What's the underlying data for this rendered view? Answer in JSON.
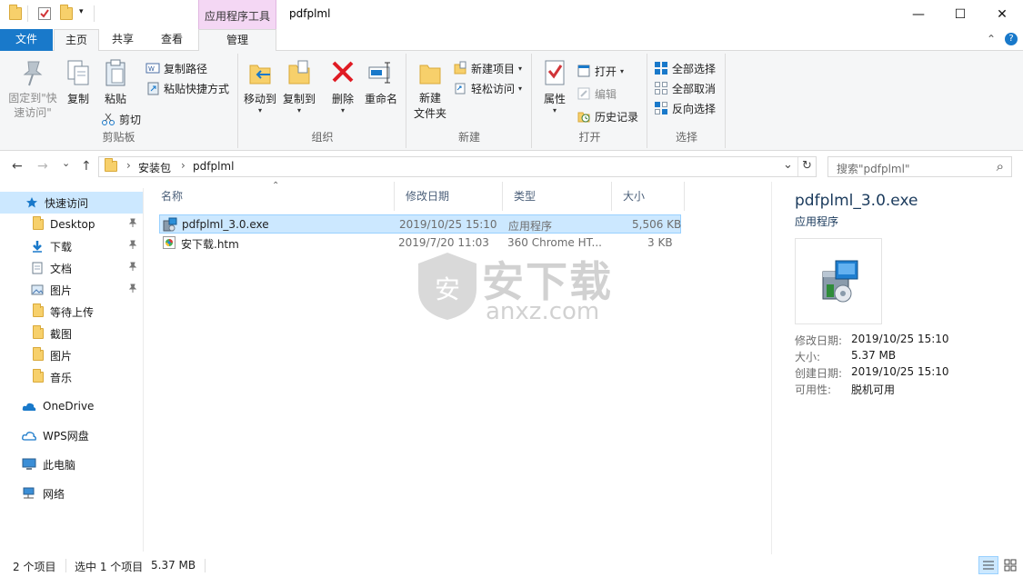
{
  "window": {
    "title": "pdfplml",
    "context_tab_header": "应用程序工具",
    "minimize_glyph": "—",
    "maximize_glyph": "☐",
    "close_glyph": "✕"
  },
  "ribbon_tabs": {
    "file": "文件",
    "home": "主页",
    "share": "共享",
    "view": "查看",
    "manage": "管理",
    "collapse_glyph": "⌃",
    "help_glyph": "?"
  },
  "ribbon": {
    "clipboard": {
      "label": "剪贴板",
      "pin_quick_access": "固定到\"快速访问\"",
      "copy": "复制",
      "paste": "粘贴",
      "copy_path": "复制路径",
      "paste_shortcut": "粘贴快捷方式",
      "cut": "剪切"
    },
    "organize": {
      "label": "组织",
      "move_to": "移动到",
      "copy_to": "复制到",
      "delete": "删除",
      "rename": "重命名"
    },
    "new": {
      "label": "新建",
      "new_folder": "新建\n文件夹",
      "new_item": "新建项目",
      "easy_access": "轻松访问"
    },
    "open": {
      "label": "打开",
      "properties": "属性",
      "open": "打开",
      "edit": "编辑",
      "history": "历史记录"
    },
    "select": {
      "label": "选择",
      "select_all": "全部选择",
      "select_none": "全部取消",
      "invert": "反向选择"
    }
  },
  "address": {
    "back_glyph": "←",
    "forward_glyph": "→",
    "recent_glyph": "⌄",
    "up_glyph": "↑",
    "breadcrumb": [
      "安装包",
      "pdfplml"
    ],
    "separator": "›",
    "dropdown_glyph": "⌄",
    "refresh_glyph": "↻",
    "search_placeholder": "搜索\"pdfplml\"",
    "search_glyph": "⌕"
  },
  "navpane": {
    "quick_access": "快速访问",
    "items": [
      {
        "label": "Desktop",
        "pinned": true
      },
      {
        "label": "下载",
        "pinned": true
      },
      {
        "label": "文档",
        "pinned": true
      },
      {
        "label": "图片",
        "pinned": true
      },
      {
        "label": "等待上传",
        "pinned": false
      },
      {
        "label": "截图",
        "pinned": false
      },
      {
        "label": "图片",
        "pinned": false
      },
      {
        "label": "音乐",
        "pinned": false
      }
    ],
    "onedrive": "OneDrive",
    "wps": "WPS网盘",
    "this_pc": "此电脑",
    "network": "网络",
    "pin_glyph": "📌"
  },
  "filelist": {
    "sort_glyph": "⌃",
    "columns": [
      "名称",
      "修改日期",
      "类型",
      "大小"
    ],
    "rows": [
      {
        "name": "pdfplml_3.0.exe",
        "modified": "2019/10/25 15:10",
        "type": "应用程序",
        "size": "5,506 KB",
        "selected": true
      },
      {
        "name": "安下载.htm",
        "modified": "2019/7/20 11:03",
        "type": "360 Chrome HT...",
        "size": "3 KB",
        "selected": false
      }
    ]
  },
  "watermark": {
    "text": "安下载",
    "url": "anxz.com"
  },
  "details": {
    "filename": "pdfplml_3.0.exe",
    "filetype": "应用程序",
    "props": [
      {
        "key": "修改日期:",
        "value": "2019/10/25 15:10"
      },
      {
        "key": "大小:",
        "value": "5.37 MB"
      },
      {
        "key": "创建日期:",
        "value": "2019/10/25 15:10"
      },
      {
        "key": "可用性:",
        "value": "脱机可用"
      }
    ]
  },
  "statusbar": {
    "count": "2 个项目",
    "selected": "选中 1 个项目",
    "size": "5.37 MB"
  },
  "colors": {
    "accent": "#1979ca",
    "selection": "#cce8ff",
    "context_tab": "#f4d7f4"
  }
}
